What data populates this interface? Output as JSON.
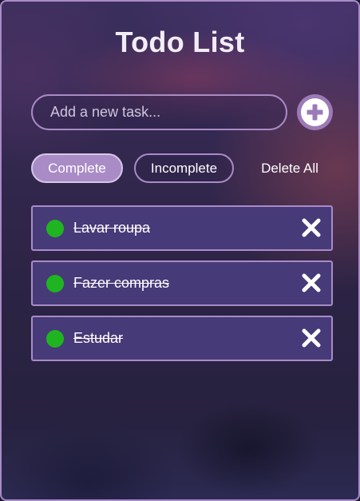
{
  "app": {
    "title": "Todo List"
  },
  "input": {
    "placeholder": "Add a new task...",
    "value": ""
  },
  "add_button": {
    "icon": "plus-icon",
    "color": "#9c7ab7"
  },
  "filters": {
    "complete_label": "Complete",
    "incomplete_label": "Incomplete",
    "delete_all_label": "Delete All",
    "active": "Complete"
  },
  "tasks": [
    {
      "text": "Lavar roupa",
      "completed": true
    },
    {
      "text": "Fazer compras",
      "completed": true
    },
    {
      "text": "Estudar",
      "completed": true
    }
  ],
  "colors": {
    "accent": "#a98bc6",
    "task_background": "#463a78",
    "status_complete": "#1fb520"
  }
}
